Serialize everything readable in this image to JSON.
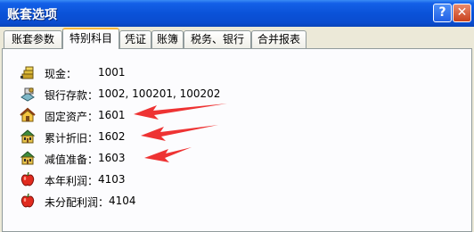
{
  "window": {
    "title": "账套选项",
    "help_label": "?",
    "close_label": "✕"
  },
  "tabs": [
    {
      "label": "账套参数"
    },
    {
      "label": "特别科目"
    },
    {
      "label": "凭证"
    },
    {
      "label": "账簿"
    },
    {
      "label": "税务、银行"
    },
    {
      "label": "合并报表"
    }
  ],
  "active_tab": "特别科目",
  "accounts": [
    {
      "label": "现金：",
      "value": "1001",
      "icon": "cash-icon"
    },
    {
      "label": "银行存款：",
      "value": "1002, 100201, 100202",
      "icon": "bank-icon"
    },
    {
      "label": "固定资产：",
      "value": "1601",
      "icon": "house-icon"
    },
    {
      "label": "累计折旧：",
      "value": "1602",
      "icon": "building-icon"
    },
    {
      "label": "减值准备：",
      "value": "1603",
      "icon": "building-icon"
    },
    {
      "label": "本年利润：",
      "value": "4103",
      "icon": "apple-icon"
    },
    {
      "label": "未分配利润：",
      "value": "4104",
      "icon": "apple-icon"
    }
  ],
  "colors": {
    "arrow": "#ee3333",
    "title_bar": "#0a52d8",
    "tab_highlight": "#f5b941"
  }
}
